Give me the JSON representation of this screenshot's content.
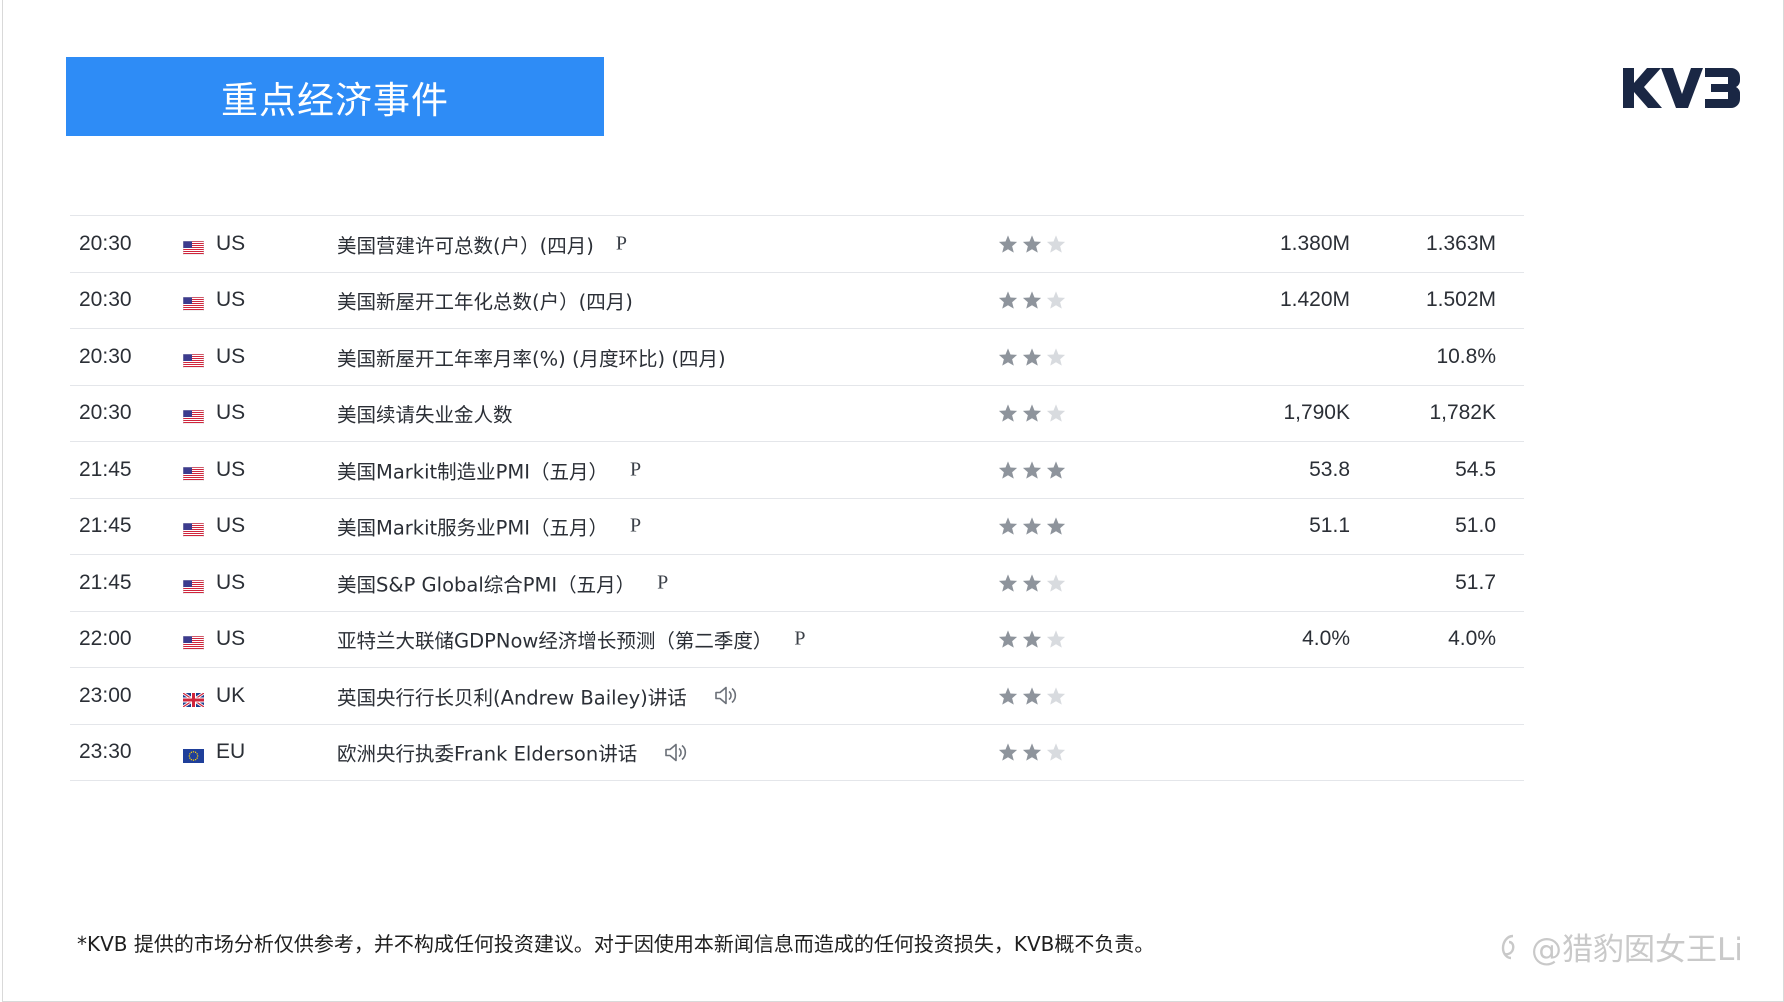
{
  "header": {
    "title": "重点经济事件",
    "logo_text": "KVB"
  },
  "colors": {
    "title_bg": "#2e8cf6",
    "star_on": "#8e949c",
    "star_off": "#d8dbdf",
    "row_border": "#e4e6ea"
  },
  "events": [
    {
      "time": "20:30",
      "flag": "us-flag-icon",
      "country": "US",
      "event": "美国营建许可总数(户）(四月)",
      "tag": "P",
      "speaker": false,
      "stars": 2,
      "previous": "1.380M",
      "forecast": "1.363M"
    },
    {
      "time": "20:30",
      "flag": "us-flag-icon",
      "country": "US",
      "event": "美国新屋开工年化总数(户）(四月)",
      "tag": "",
      "speaker": false,
      "stars": 2,
      "previous": "1.420M",
      "forecast": "1.502M"
    },
    {
      "time": "20:30",
      "flag": "us-flag-icon",
      "country": "US",
      "event": "美国新屋开工年率月率(%) (月度环比) (四月)",
      "tag": "",
      "speaker": false,
      "stars": 2,
      "previous": "",
      "forecast": "10.8%"
    },
    {
      "time": "20:30",
      "flag": "us-flag-icon",
      "country": "US",
      "event": "美国续请失业金人数",
      "tag": "",
      "speaker": false,
      "stars": 2,
      "previous": "1,790K",
      "forecast": "1,782K"
    },
    {
      "time": "21:45",
      "flag": "us-flag-icon",
      "country": "US",
      "event": "美国Markit制造业PMI（五月）",
      "tag": "P",
      "speaker": false,
      "stars": 3,
      "previous": "53.8",
      "forecast": "54.5"
    },
    {
      "time": "21:45",
      "flag": "us-flag-icon",
      "country": "US",
      "event": "美国Markit服务业PMI（五月）",
      "tag": "P",
      "speaker": false,
      "stars": 3,
      "previous": "51.1",
      "forecast": "51.0"
    },
    {
      "time": "21:45",
      "flag": "us-flag-icon",
      "country": "US",
      "event": "美国S&P Global综合PMI（五月）",
      "tag": "P",
      "speaker": false,
      "stars": 2,
      "previous": "",
      "forecast": "51.7"
    },
    {
      "time": "22:00",
      "flag": "us-flag-icon",
      "country": "US",
      "event": "亚特兰大联储GDPNow经济增长预测（第二季度）",
      "tag": "P",
      "speaker": false,
      "stars": 2,
      "previous": "4.0%",
      "forecast": "4.0%"
    },
    {
      "time": "23:00",
      "flag": "uk-flag-icon",
      "country": "UK",
      "event": "英国央行行长贝利(Andrew Bailey)讲话",
      "tag": "",
      "speaker": true,
      "stars": 2,
      "previous": "",
      "forecast": ""
    },
    {
      "time": "23:30",
      "flag": "eu-flag-icon",
      "country": "EU",
      "event": "欧洲央行执委Frank Elderson讲话",
      "tag": "",
      "speaker": true,
      "stars": 2,
      "previous": "",
      "forecast": ""
    }
  ],
  "footer": {
    "disclaimer": "*KVB 提供的市场分析仅供参考，并不构成任何投资建议。对于因使用本新闻信息而造成的任何投资损失，KVB概不负责。",
    "watermark": "@猎豹囡女王Li"
  }
}
